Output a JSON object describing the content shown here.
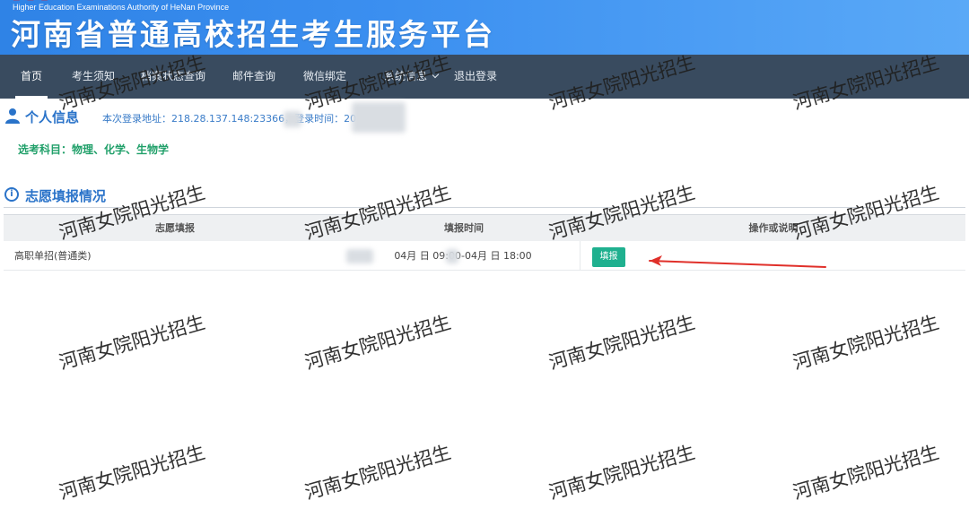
{
  "header": {
    "en_title": "Higher Education Examinations Authority of HeNan Province",
    "cn_title": "河南省普通高校招生考生服务平台"
  },
  "nav": {
    "items": [
      {
        "label": "首页",
        "active": true
      },
      {
        "label": "考生须知"
      },
      {
        "label": "档案状态查询"
      },
      {
        "label": "邮件查询"
      },
      {
        "label": "微信绑定"
      },
      {
        "label": "系统信息",
        "has_dropdown": true
      },
      {
        "label": "退出登录"
      }
    ]
  },
  "personal": {
    "title": "个人信息",
    "login_info": "本次登录地址：218.28.137.148:23366，登录时间：20",
    "subjects": "选考科目：物理、化学、生物学"
  },
  "volunteer": {
    "title": "志愿填报情况",
    "columns": [
      "志愿填报",
      "填报时间",
      "操作或说明"
    ],
    "rows": [
      {
        "name": "高职单招(普通类)",
        "time": "04月  日 09:00-04月  日 18:00",
        "action": "填报"
      }
    ]
  },
  "watermark": {
    "text": "河南女院阳光招生"
  },
  "colors": {
    "banner": "#3b8ff0",
    "navbar": "#394b5f",
    "accent": "#2a73c9",
    "green": "#21a06a",
    "button": "#1fb08f",
    "arrow": "#e0302a"
  },
  "icons": {
    "personal": "user-icon",
    "volunteer": "info-circle-icon",
    "dropdown": "chevron-down-icon",
    "annotation": "red-arrow-icon"
  }
}
